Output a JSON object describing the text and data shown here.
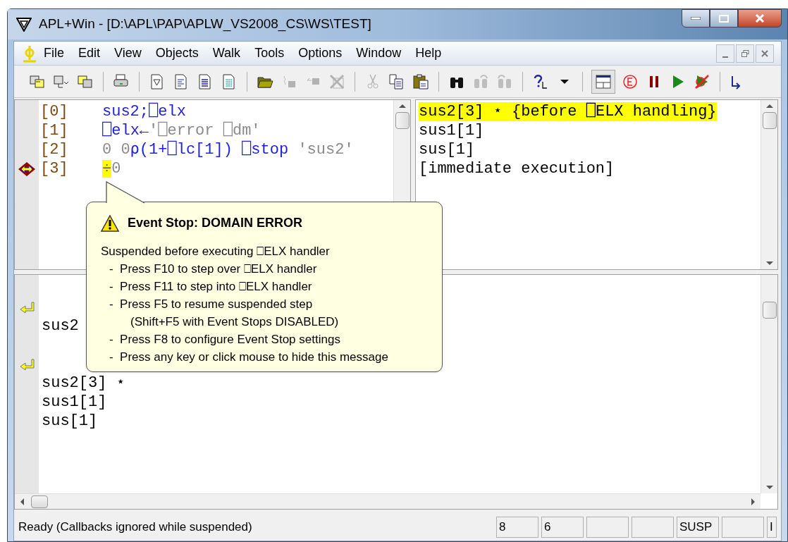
{
  "window": {
    "title": "APL+Win - [D:\\APL\\PAP\\APLW_VS2008_CS\\WS\\TEST]"
  },
  "menu": [
    "File",
    "Edit",
    "View",
    "Objects",
    "Walk",
    "Tools",
    "Options",
    "Window",
    "Help"
  ],
  "toolbar": [
    {
      "kind": "copy-window",
      "disabled": false
    },
    {
      "kind": "window-dropdown",
      "disabled": false
    },
    {
      "kind": "paste-window",
      "disabled": false
    },
    {
      "kind": "sep"
    },
    {
      "kind": "print",
      "disabled": false
    },
    {
      "kind": "sep"
    },
    {
      "kind": "function-doc",
      "disabled": false
    },
    {
      "kind": "text-doc",
      "disabled": false
    },
    {
      "kind": "lines-doc",
      "disabled": false
    },
    {
      "kind": "grid-doc",
      "disabled": false
    },
    {
      "kind": "sep"
    },
    {
      "kind": "folder",
      "disabled": false
    },
    {
      "kind": "step-back",
      "disabled": true
    },
    {
      "kind": "step-in",
      "disabled": true
    },
    {
      "kind": "delete",
      "disabled": true
    },
    {
      "kind": "sep"
    },
    {
      "kind": "cut",
      "disabled": true
    },
    {
      "kind": "copy",
      "disabled": false
    },
    {
      "kind": "paste",
      "disabled": false
    },
    {
      "kind": "sep"
    },
    {
      "kind": "find",
      "disabled": false
    },
    {
      "kind": "find-next",
      "disabled": true
    },
    {
      "kind": "find-prev",
      "disabled": true
    },
    {
      "kind": "sep"
    },
    {
      "kind": "help",
      "disabled": false
    },
    {
      "kind": "caret",
      "disabled": false
    },
    {
      "kind": "sep"
    },
    {
      "kind": "layout",
      "pressed": true
    },
    {
      "kind": "event",
      "disabled": false
    },
    {
      "kind": "pause",
      "disabled": false
    },
    {
      "kind": "run",
      "disabled": false
    },
    {
      "kind": "run-crossed",
      "disabled": false
    },
    {
      "kind": "sep"
    },
    {
      "kind": "return",
      "disabled": false
    }
  ],
  "code_lines": [
    {
      "number": "[0]",
      "current": false,
      "tokens": [
        {
          "text": "sus2;⎕elx",
          "kind": "name"
        }
      ]
    },
    {
      "number": "[1]",
      "current": false,
      "tokens": [
        {
          "text": "⎕elx←",
          "kind": "name"
        },
        {
          "text": "'⎕error ⎕dm'",
          "kind": "literal"
        }
      ]
    },
    {
      "number": "[2]",
      "current": false,
      "tokens": [
        {
          "text": "0 0",
          "kind": "literal"
        },
        {
          "text": "⍴(1+⎕lc[1]) ⎕stop ",
          "kind": "name"
        },
        {
          "text": "'sus2'",
          "kind": "literal"
        }
      ]
    },
    {
      "number": "[3]",
      "current": true,
      "tokens": [
        {
          "text": "÷",
          "kind": "error"
        },
        {
          "text": "0",
          "kind": "literal"
        }
      ]
    }
  ],
  "stack": [
    {
      "text": "sus2[3] ⋆ {before ⎕ELX handling}",
      "selected": true
    },
    {
      "text": "sus1[1]",
      "selected": false
    },
    {
      "text": "sus[1]",
      "selected": false
    },
    {
      "text": "[immediate execution]",
      "selected": false
    }
  ],
  "session": [
    {
      "marker": true
    },
    {
      "marker": false,
      "text": "sus2"
    },
    {
      "marker": false
    },
    {
      "marker": true
    },
    {
      "marker": false,
      "text": "sus2[3] ⋆"
    },
    {
      "marker": false,
      "text": "sus1[1]"
    },
    {
      "marker": false,
      "text": "sus[1]"
    }
  ],
  "tooltip": {
    "title": "Event Stop: DOMAIN ERROR",
    "lines": [
      {
        "kind": "text",
        "text": "Suspended before executing ⎕ELX handler"
      },
      {
        "kind": "bullet",
        "text": "-  Press F10 to step over ⎕ELX handler"
      },
      {
        "kind": "bullet",
        "text": "-  Press F11 to step into ⎕ELX handler"
      },
      {
        "kind": "bullet",
        "text": "-  Press F5 to resume suspended step"
      },
      {
        "kind": "note",
        "text": "(Shift+F5 with Event Stops DISABLED)"
      },
      {
        "kind": "bullet",
        "text": "-  Press F8 to configure Event Stop settings"
      },
      {
        "kind": "bullet",
        "text": "-  Press any key or click mouse to hide this message"
      }
    ]
  },
  "status_bar": {
    "message": "Ready (Callbacks ignored while suspended)",
    "panels": [
      {
        "kind": "text",
        "text": "8"
      },
      {
        "kind": "text",
        "text": "6"
      },
      {
        "kind": "blank"
      },
      {
        "kind": "blank"
      },
      {
        "kind": "text",
        "text": "SUSP"
      },
      {
        "kind": "blank"
      },
      {
        "kind": "text",
        "text": "I"
      }
    ]
  }
}
